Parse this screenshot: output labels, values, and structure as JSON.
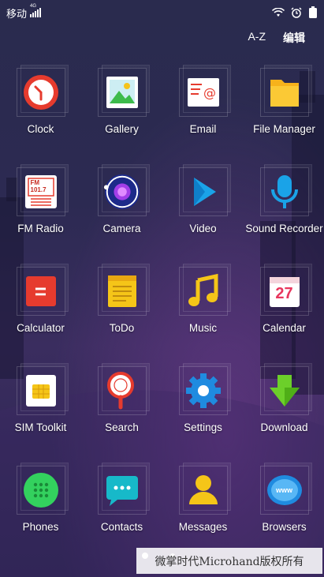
{
  "status_bar": {
    "carrier": "移动",
    "network": "4G"
  },
  "topbar": {
    "sort_label": "A-Z",
    "edit_label": "编辑"
  },
  "apps": [
    {
      "label": "Clock"
    },
    {
      "label": "Gallery"
    },
    {
      "label": "Email"
    },
    {
      "label": "File Manager"
    },
    {
      "label": "FM Radio",
      "icon_text": "FM 101.7"
    },
    {
      "label": "Camera"
    },
    {
      "label": "Video"
    },
    {
      "label": "Sound Recorder"
    },
    {
      "label": "Calculator",
      "icon_text": "="
    },
    {
      "label": "ToDo"
    },
    {
      "label": "Music"
    },
    {
      "label": "Calendar",
      "icon_text": "27"
    },
    {
      "label": "SIM Toolkit"
    },
    {
      "label": "Search"
    },
    {
      "label": "Settings"
    },
    {
      "label": "Download"
    },
    {
      "label": "Phones"
    },
    {
      "label": "Contacts"
    },
    {
      "label": "Messages"
    },
    {
      "label": "Browsers",
      "icon_text": "www"
    }
  ],
  "watermark": "微掌时代Microhand版权所有",
  "colors": {
    "background": "#2c2a52",
    "clock_red": "#e63b2e",
    "file_yellow": "#f6b21b",
    "music_yellow": "#f5c518",
    "download_green": "#6ccf2a",
    "settings_blue": "#1f8be0",
    "video_blue": "#1aa3e8"
  }
}
